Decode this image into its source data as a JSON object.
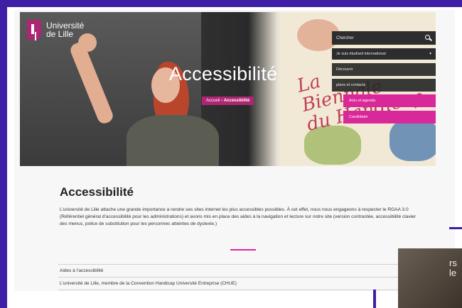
{
  "brand": {
    "logo_line1": "Université",
    "logo_line2": "de Lille",
    "accent": "#ae2573",
    "pink": "#d8289a",
    "frame": "#3e1fa6"
  },
  "hero": {
    "title": "Accessibilité",
    "breadcrumb_home": "Accueil",
    "breadcrumb_sep": " › ",
    "breadcrumb_current": "Accessibilité",
    "poster_text_line1": "La",
    "poster_text_line2": "Biennale",
    "poster_text_line3": "du Handicap"
  },
  "nav": {
    "search_placeholder": "Chercher",
    "profile_select": "Je suis  étudiant international",
    "menu": [
      "Découvrir",
      "plans et contacts"
    ],
    "actions": [
      "Actu et agenda",
      "Candidater"
    ]
  },
  "content": {
    "title": "Accessibilité",
    "body": "L’université de Lille attache une grande importance à rendre ses sites internet les plus accessibles possibles. À cet effet, nous nous engageons à respecter le RGAA 3.0 (Référentiel général d’accessibilité pour les administrations) et avons mis en place des aides à la navigation et lecture sur notre site (version contrastée, accessibilité clavier des menus, police de substitution pour les personnes atteintes de dyslexie.)",
    "links": [
      {
        "label": "Aides à l’accessibilité",
        "arrow": "»"
      },
      {
        "label": "L’université de Lille, membre de la Convention Handicap Université Entreprise (CHUE)",
        "arrow": "»"
      }
    ]
  },
  "thumbnail": {
    "text_line1": "rs",
    "text_line2": "le"
  }
}
